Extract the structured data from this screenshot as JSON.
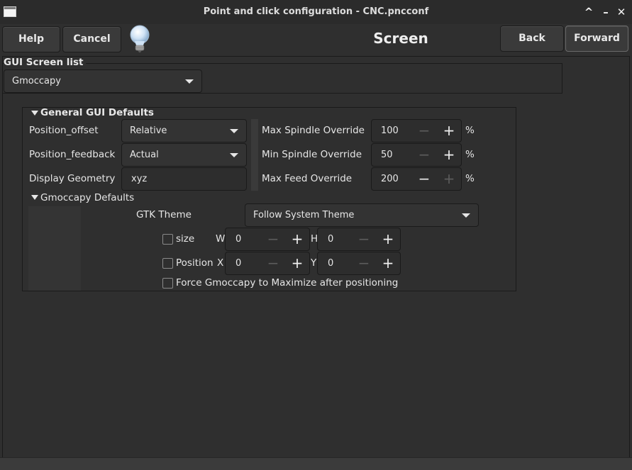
{
  "window": {
    "title": "Point and click configuration - CNC.pncconf",
    "controls": {
      "restore": "^",
      "minimize": "–",
      "close": "✕"
    }
  },
  "toolbar": {
    "help_label": "Help",
    "cancel_label": "Cancel",
    "back_label": "Back",
    "forward_label": "Forward",
    "page_title": "Screen"
  },
  "gui_screen_list": {
    "label": "GUI Screen list",
    "selected": "Gmoccapy"
  },
  "general_defaults": {
    "label": "General GUI Defaults",
    "position_offset": {
      "label": "Position_offset",
      "value": "Relative"
    },
    "position_feedback": {
      "label": "Position_feedback",
      "value": "Actual"
    },
    "display_geometry": {
      "label": "Display Geometry",
      "value": "xyz"
    },
    "max_spindle_override": {
      "label": "Max Spindle Override",
      "value": "100",
      "unit": "%"
    },
    "min_spindle_override": {
      "label": "Min Spindle Override",
      "value": "50",
      "unit": "%"
    },
    "max_feed_override": {
      "label": "Max Feed Override",
      "value": "200",
      "unit": "%"
    }
  },
  "gmoccapy_defaults": {
    "label": "Gmoccapy Defaults",
    "gtk_theme": {
      "label": "GTK Theme",
      "value": "Follow System Theme"
    },
    "size": {
      "label": "size",
      "w_label": "W",
      "w_value": "0",
      "h_label": "H",
      "h_value": "0",
      "checked": false
    },
    "position": {
      "label": "Position",
      "x_label": "X",
      "x_value": "0",
      "y_label": "Y",
      "y_value": "0",
      "checked": false
    },
    "maximize": {
      "label": "Force Gmoccapy to Maximize after positioning",
      "checked": false
    }
  },
  "icons": {
    "spin_minus": "−",
    "spin_plus": "+"
  }
}
